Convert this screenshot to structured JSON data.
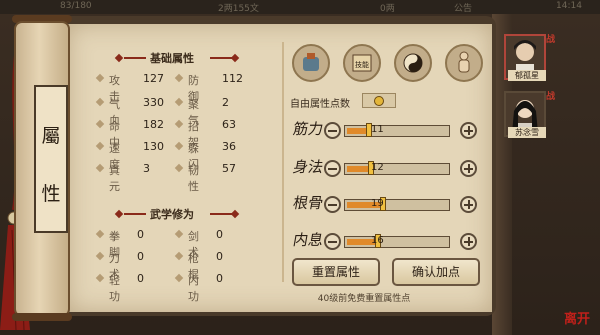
{
  "topbar": {
    "left": "83/180",
    "center": "2两155文",
    "right_value": "0两",
    "notice": "公告",
    "time": "14:14"
  },
  "scroll_title": [
    "屬",
    "性"
  ],
  "basic": {
    "title": "基础属性",
    "stats": [
      {
        "label": "攻击",
        "value": "127"
      },
      {
        "label": "防御",
        "value": "112"
      },
      {
        "label": "气血",
        "value": "330"
      },
      {
        "label": "聚气",
        "value": "2"
      },
      {
        "label": "命中",
        "value": "182"
      },
      {
        "label": "招架",
        "value": "63"
      },
      {
        "label": "速度",
        "value": "130"
      },
      {
        "label": "躲闪",
        "value": "36"
      },
      {
        "label": "真元",
        "value": "3"
      },
      {
        "label": "韧性",
        "value": "57"
      }
    ]
  },
  "martial": {
    "title": "武学修为",
    "stats": [
      {
        "label": "拳脚",
        "value": "0"
      },
      {
        "label": "剑术",
        "value": "0"
      },
      {
        "label": "刀术",
        "value": "0"
      },
      {
        "label": "枪棍",
        "value": "0"
      },
      {
        "label": "轻功",
        "value": "0"
      },
      {
        "label": "内功",
        "value": "0"
      }
    ]
  },
  "icons": [
    {
      "name": "equipment-icon",
      "label": ""
    },
    {
      "name": "skill-book-icon",
      "label": "技能"
    },
    {
      "name": "yin-yang-icon",
      "label": ""
    },
    {
      "name": "meridian-body-icon",
      "label": ""
    }
  ],
  "free_points_label": "自由属性点数",
  "free_points_value": "0",
  "attributes": [
    {
      "glyph": "筋力",
      "value": "11",
      "level": 0.19
    },
    {
      "glyph": "身法",
      "value": "12",
      "level": 0.21
    },
    {
      "glyph": "根骨",
      "value": "19",
      "level": 0.33
    },
    {
      "glyph": "内息",
      "value": "16",
      "level": 0.28
    }
  ],
  "buttons": {
    "reset": "重置属性",
    "confirm": "确认加点"
  },
  "note": "40级前免费重置属性点",
  "characters": [
    {
      "name": "郁孤星",
      "tag": "战"
    },
    {
      "name": "苏念雪",
      "tag": "战"
    }
  ],
  "seal": "离开",
  "colors": {
    "accent": "#8a2a1a",
    "bar_fill": "#e08a2a",
    "paper": "#e4d6b8"
  }
}
